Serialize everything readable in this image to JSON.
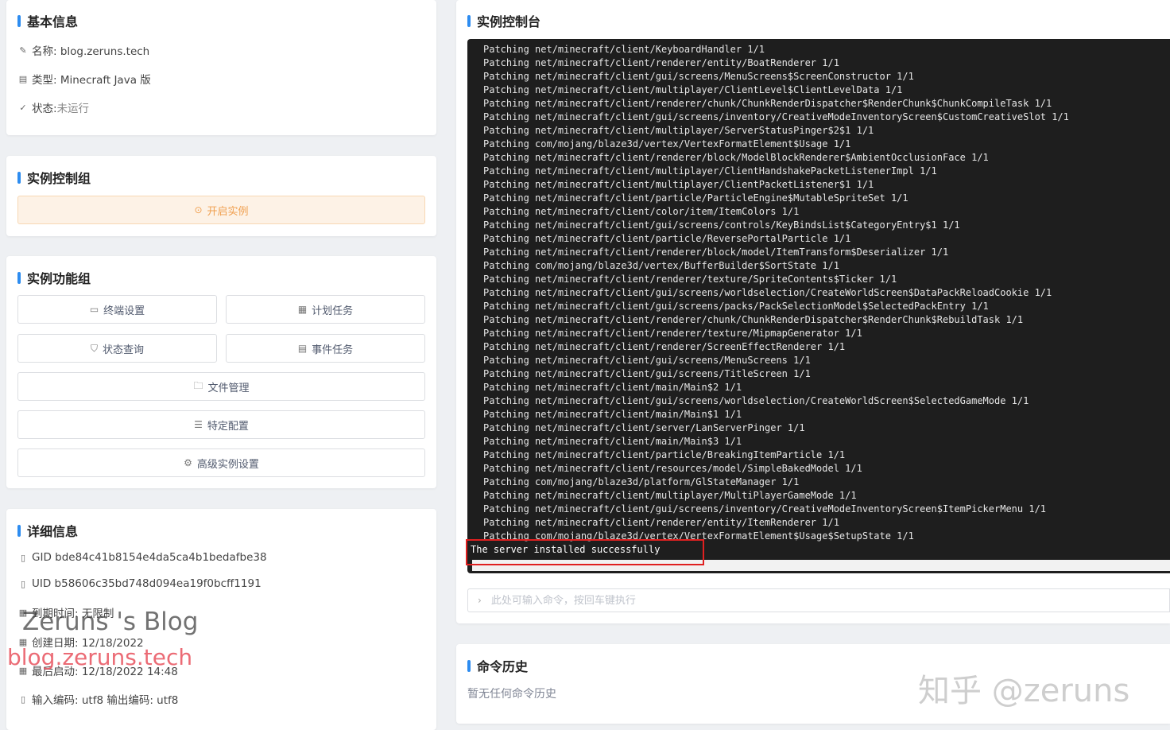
{
  "basic": {
    "title": "基本信息",
    "name": "名称: blog.zeruns.tech",
    "type": "类型: Minecraft Java 版",
    "status_label": "状态: ",
    "status_value": "未运行"
  },
  "control": {
    "title": "实例控制组",
    "start_label": "开启实例"
  },
  "functions": {
    "title": "实例功能组",
    "terminal": "终端设置",
    "schedule": "计划任务",
    "status_query": "状态查询",
    "events": "事件任务",
    "files": "文件管理",
    "config": "特定配置",
    "advanced": "高级实例设置"
  },
  "details": {
    "title": "详细信息",
    "gid": "GID bde84c41b8154e4da5ca4b1bedafbe38",
    "uid": "UID b58606c35bd748d094ea19f0bcff1191",
    "expire": "到期时间: 无限制",
    "created": "创建日期: 12/18/2022",
    "last_start": "最后启动: 12/18/2022 14:48",
    "encoding": "输入编码: utf8 输出编码: utf8"
  },
  "console": {
    "title": "实例控制台",
    "lines": [
      "Patching net/minecraft/client/KeyboardHandler 1/1",
      "Patching net/minecraft/client/renderer/entity/BoatRenderer 1/1",
      "Patching net/minecraft/client/gui/screens/MenuScreens$ScreenConstructor 1/1",
      "Patching net/minecraft/client/multiplayer/ClientLevel$ClientLevelData 1/1",
      "Patching net/minecraft/client/renderer/chunk/ChunkRenderDispatcher$RenderChunk$ChunkCompileTask 1/1",
      "Patching net/minecraft/client/gui/screens/inventory/CreativeModeInventoryScreen$CustomCreativeSlot 1/1",
      "Patching net/minecraft/client/multiplayer/ServerStatusPinger$2$1 1/1",
      "Patching com/mojang/blaze3d/vertex/VertexFormatElement$Usage 1/1",
      "Patching net/minecraft/client/renderer/block/ModelBlockRenderer$AmbientOcclusionFace 1/1",
      "Patching net/minecraft/client/multiplayer/ClientHandshakePacketListenerImpl 1/1",
      "Patching net/minecraft/client/multiplayer/ClientPacketListener$1 1/1",
      "Patching net/minecraft/client/particle/ParticleEngine$MutableSpriteSet 1/1",
      "Patching net/minecraft/client/color/item/ItemColors 1/1",
      "Patching net/minecraft/client/gui/screens/controls/KeyBindsList$CategoryEntry$1 1/1",
      "Patching net/minecraft/client/particle/ReversePortalParticle 1/1",
      "Patching net/minecraft/client/renderer/block/model/ItemTransform$Deserializer 1/1",
      "Patching com/mojang/blaze3d/vertex/BufferBuilder$SortState 1/1",
      "Patching net/minecraft/client/renderer/texture/SpriteContents$Ticker 1/1",
      "Patching net/minecraft/client/gui/screens/worldselection/CreateWorldScreen$DataPackReloadCookie 1/1",
      "Patching net/minecraft/client/gui/screens/packs/PackSelectionModel$SelectedPackEntry 1/1",
      "Patching net/minecraft/client/renderer/chunk/ChunkRenderDispatcher$RenderChunk$RebuildTask 1/1",
      "Patching net/minecraft/client/renderer/texture/MipmapGenerator 1/1",
      "Patching net/minecraft/client/renderer/ScreenEffectRenderer 1/1",
      "Patching net/minecraft/client/gui/screens/MenuScreens 1/1",
      "Patching net/minecraft/client/gui/screens/TitleScreen 1/1",
      "Patching net/minecraft/client/main/Main$2 1/1",
      "Patching net/minecraft/client/gui/screens/worldselection/CreateWorldScreen$SelectedGameMode 1/1",
      "Patching net/minecraft/client/main/Main$1 1/1",
      "Patching net/minecraft/client/server/LanServerPinger 1/1",
      "Patching net/minecraft/client/main/Main$3 1/1",
      "Patching net/minecraft/client/particle/BreakingItemParticle 1/1",
      "Patching net/minecraft/client/resources/model/SimpleBakedModel 1/1",
      "Patching com/mojang/blaze3d/platform/GlStateManager 1/1",
      "Patching net/minecraft/client/multiplayer/MultiPlayerGameMode 1/1",
      "Patching net/minecraft/client/gui/screens/inventory/CreativeModeInventoryScreen$ItemPickerMenu 1/1",
      "Patching net/minecraft/client/renderer/entity/ItemRenderer 1/1",
      "Patching com/mojang/blaze3d/vertex/VertexFormatElement$Usage$SetupState 1/1"
    ],
    "last_line": "The server installed successfully",
    "input_placeholder": "此处可输入命令，按回车键执行"
  },
  "history": {
    "title": "命令历史",
    "empty": "暂无任何命令历史"
  },
  "watermarks": {
    "blog_name": "Zeruns 's Blog",
    "blog_url": "blog.zeruns.tech",
    "zhihu": "知乎 @zeruns"
  }
}
